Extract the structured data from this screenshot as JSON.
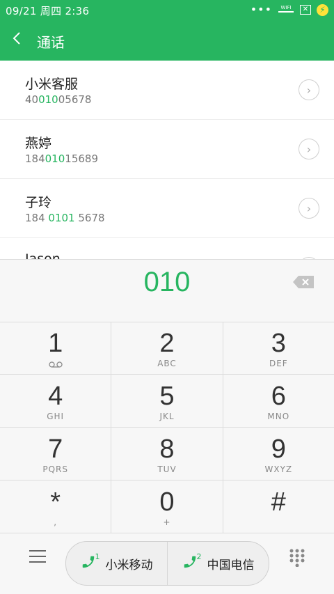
{
  "status_bar": {
    "time": "09/21 周四 2:36",
    "dots": "•••",
    "wifi_label": "WIFI",
    "sim_icon": "✕",
    "battery_icon": "⚡"
  },
  "title_bar": {
    "back_icon": "chevron-left-icon",
    "title": "通话"
  },
  "results": [
    {
      "name": "小米客服",
      "number_pre": "40",
      "number_match": "010",
      "number_post": "05678"
    },
    {
      "name": "燕婷",
      "number_pre": "184",
      "number_match": "010",
      "number_post": "15689"
    },
    {
      "name": "子玲",
      "number_pre": "184 ",
      "number_match": "0101",
      "number_post": " 5678"
    },
    {
      "name": "Jason",
      "number_pre": "",
      "number_match": "",
      "number_post": ""
    }
  ],
  "dialer": {
    "digits": "010",
    "keys": [
      {
        "digit": "1",
        "letters": ""
      },
      {
        "digit": "2",
        "letters": "ABC"
      },
      {
        "digit": "3",
        "letters": "DEF"
      },
      {
        "digit": "4",
        "letters": "GHI"
      },
      {
        "digit": "5",
        "letters": "JKL"
      },
      {
        "digit": "6",
        "letters": "MNO"
      },
      {
        "digit": "7",
        "letters": "PQRS"
      },
      {
        "digit": "8",
        "letters": "TUV"
      },
      {
        "digit": "9",
        "letters": "WXYZ"
      },
      {
        "digit": "*",
        "letters": ","
      },
      {
        "digit": "0",
        "letters": "+"
      },
      {
        "digit": "#",
        "letters": ""
      }
    ]
  },
  "bottom_bar": {
    "sim1": {
      "index": "1",
      "label": "小米移动"
    },
    "sim2": {
      "index": "2",
      "label": "中国电信"
    }
  },
  "colors": {
    "accent": "#27b560",
    "background": "#f7f7f7"
  }
}
